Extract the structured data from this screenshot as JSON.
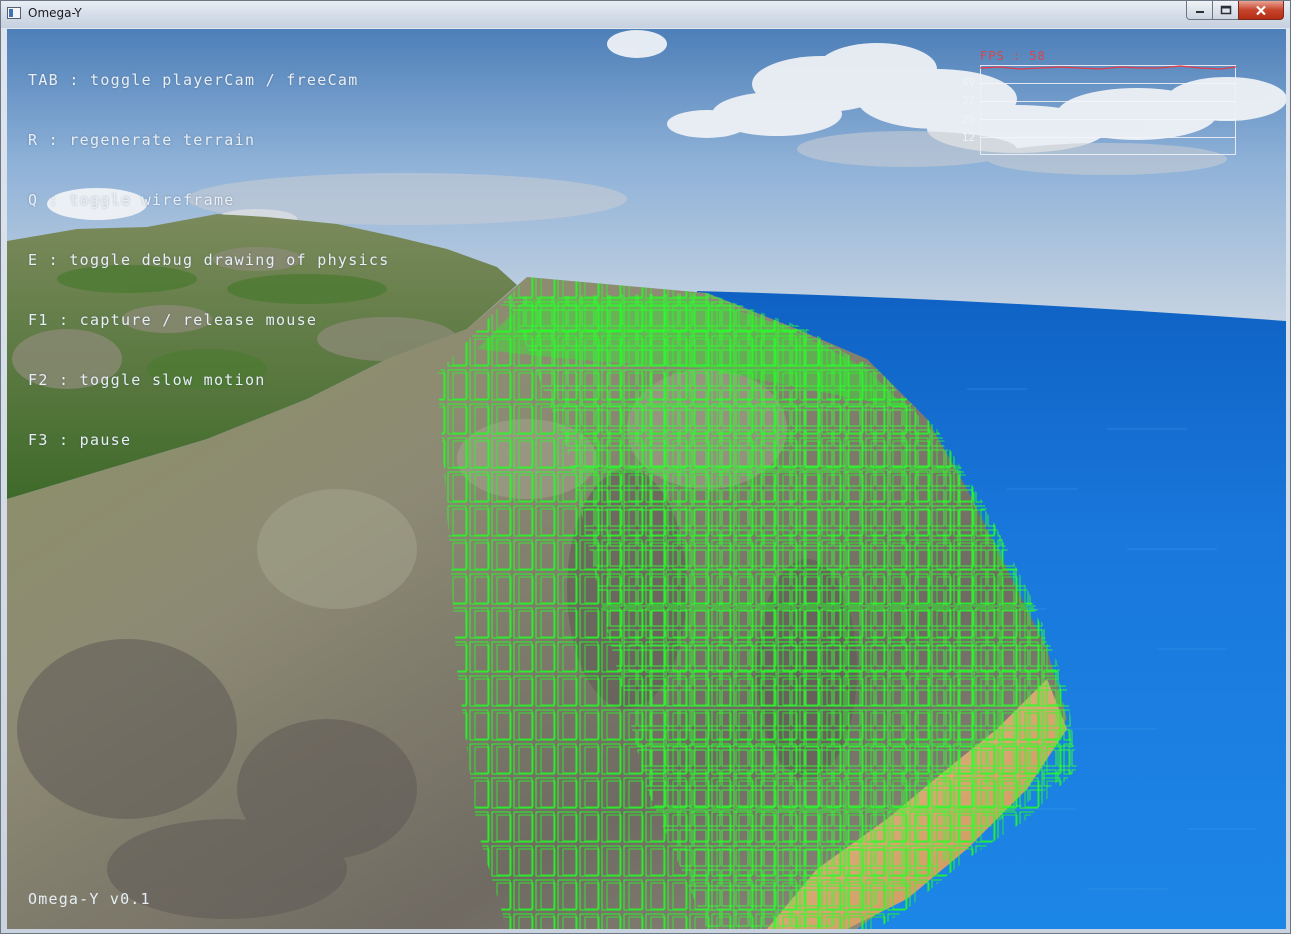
{
  "window": {
    "title": "Omega-Y",
    "controls": {
      "minimize": "minimize",
      "maximize": "maximize",
      "close": "close"
    }
  },
  "help_overlay": {
    "lines": [
      "TAB : toggle playerCam / freeCam",
      "R : regenerate terrain",
      "Q : toggle wireframe",
      "E : toggle debug drawing of physics",
      "F1 : capture / release mouse",
      "F2 : toggle slow motion",
      "F3 : pause"
    ]
  },
  "fps_graph": {
    "label": "FPS : 58",
    "ticks": [
      "49",
      "37",
      "25",
      "12"
    ],
    "line_color": "#e23a46"
  },
  "version_label": "Omega-Y v0.1",
  "scene": {
    "debug_wireframe_color": "#22ff22",
    "ocean_color": "#1a74d6",
    "sky_color": "#7aa6d3"
  }
}
